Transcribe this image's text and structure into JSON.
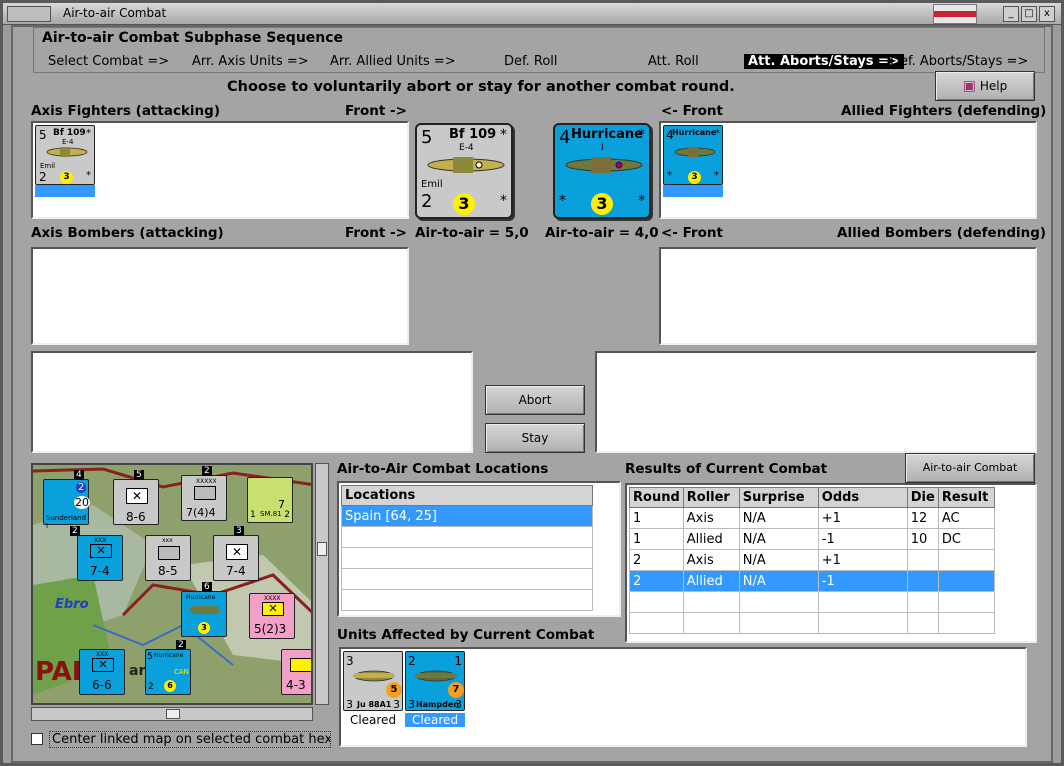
{
  "window": {
    "title": "Air-to-air Combat"
  },
  "phase": {
    "title": "Air-to-air Combat Subphase Sequence",
    "steps": [
      "Select Combat =>",
      "Arr. Axis Units =>",
      "Arr. Allied Units =>",
      "Def. Roll",
      "Att. Roll",
      "Att. Aborts/Stays =>",
      "Def. Aborts/Stays =>"
    ]
  },
  "instruction": "Choose to voluntarily abort or stay for another combat round.",
  "help_label": "Help",
  "labels": {
    "axis_fighters": "Axis Fighters (attacking)",
    "front_right": "Front ->",
    "front_left": "<- Front",
    "allied_fighters": "Allied Fighters (defending)",
    "axis_bombers": "Axis Bombers (attacking)",
    "allied_bombers": "Allied Bombers (defending)",
    "axis_a2a": "Air-to-air = 5,0",
    "allied_a2a": "Air-to-air = 4,0"
  },
  "axis_counter": {
    "factor": "5",
    "name": "Bf 109",
    "variant": "E-4",
    "nick": "Emil",
    "range": "2",
    "move": "3",
    "star": "*"
  },
  "allied_counter": {
    "factor": "4",
    "name": "Hurricane",
    "variant": "I",
    "move": "3",
    "star": "*"
  },
  "buttons": {
    "abort": "Abort",
    "stay": "Stay",
    "chart": "Air-to-air Combat Chart"
  },
  "locations": {
    "title": "Air-to-Air Combat Locations",
    "header": "Locations",
    "rows": [
      "Spain [64, 25]"
    ]
  },
  "results": {
    "title": "Results of Current Combat",
    "columns": [
      "Round",
      "Roller",
      "Surprise",
      "Odds",
      "Die",
      "Result"
    ],
    "rows": [
      [
        "1",
        "Axis",
        "N/A",
        "+1",
        "12",
        "AC"
      ],
      [
        "1",
        "Allied",
        "N/A",
        "-1",
        "10",
        "DC"
      ],
      [
        "2",
        "Axis",
        "N/A",
        "+1",
        "",
        ""
      ],
      [
        "2",
        "Allied",
        "N/A",
        "-1",
        "",
        ""
      ]
    ]
  },
  "affected": {
    "title": "Units Affected by Current Combat",
    "units": [
      {
        "top": "3",
        "name": "Ju 88A1",
        "bottom": "3",
        "right": "3",
        "circle": "5",
        "status": "Cleared"
      },
      {
        "top": "2",
        "name": "Hampden",
        "bottom": "3",
        "right": "3",
        "top_right": "1",
        "circle": "7",
        "status": "Cleared"
      }
    ]
  },
  "map": {
    "checkbox_label": "Center linked map on selected combat hex",
    "labels": [
      "Ebro",
      "PAI",
      "ar"
    ],
    "units": [
      {
        "top": "4",
        "label": "Sunderland I",
        "value": "20",
        "badge": "2"
      },
      {
        "top": "5",
        "value": "8-6"
      },
      {
        "top": "2",
        "value": "7(4)4",
        "tag": "XXXXX"
      },
      {
        "label": "SM.81",
        "value": "7",
        "bottom": "1",
        "bottom_right": "2"
      },
      {
        "top": "2",
        "value": "7-4",
        "tag": "XXX"
      },
      {
        "value": "8-5",
        "tag": "xxx"
      },
      {
        "top": "3",
        "value": "7-4"
      },
      {
        "top": "6",
        "label": "Hurricane",
        "value": "3"
      },
      {
        "value": "5(2)3",
        "tag": "XXXX"
      },
      {
        "value": "6-6",
        "tag": "XXX"
      },
      {
        "top": "2",
        "label": "Hurricane",
        "sub": "CAN",
        "value": "6",
        "left": "5",
        "bottom": "2"
      },
      {
        "value": "4-3"
      }
    ]
  },
  "colors": {
    "selection": "#3399ff",
    "allied_blue": "#0aa0dc",
    "yellow": "#ffef00"
  }
}
